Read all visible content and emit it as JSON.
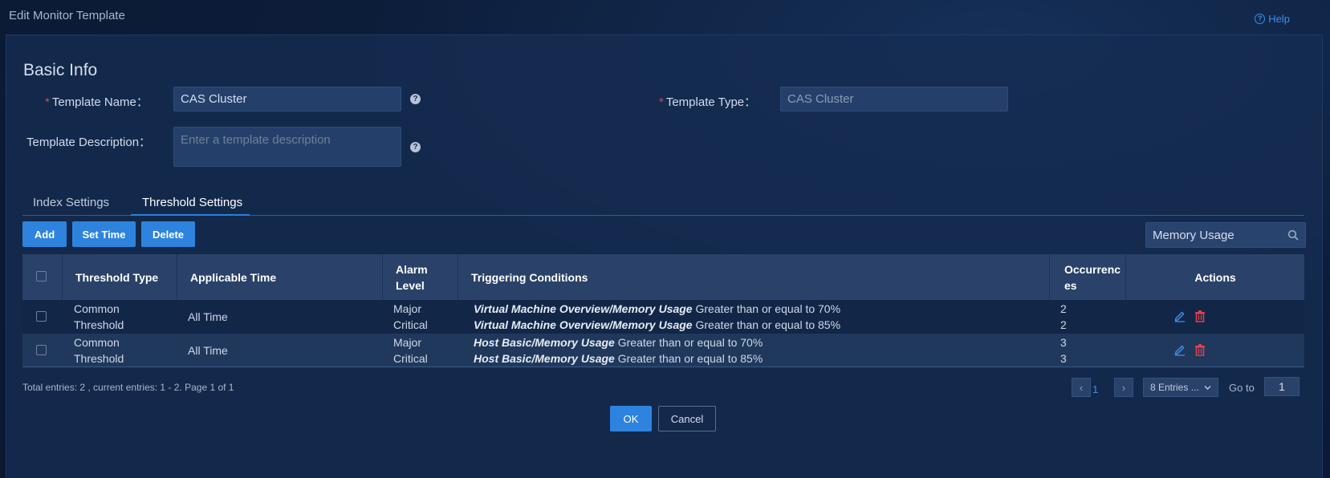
{
  "window": {
    "title": "Edit Monitor Template",
    "help_label": "Help"
  },
  "basic_info": {
    "section_title": "Basic Info",
    "template_name_label": "Template Name：",
    "template_name_value": "CAS Cluster",
    "template_type_label": "Template Type：",
    "template_type_value": "CAS Cluster",
    "template_description_label": "Template Description：",
    "template_description_placeholder": "Enter a template description",
    "required_mark": "*"
  },
  "tabs": [
    {
      "label": "Index Settings",
      "active": false
    },
    {
      "label": "Threshold Settings",
      "active": true
    }
  ],
  "toolbar": {
    "add_label": "Add",
    "set_time_label": "Set Time",
    "delete_label": "Delete",
    "search_value": "Memory Usage"
  },
  "table": {
    "headers": {
      "threshold_type": "Threshold Type",
      "applicable_time": "Applicable Time",
      "alarm_level": "Alarm Level",
      "triggering_conditions": "Triggering Conditions",
      "occurrences": "Occurrences",
      "actions": "Actions"
    },
    "rows": [
      {
        "threshold_type": "Common Threshold",
        "applicable_time": "All Time",
        "levels": [
          "Major",
          "Critical"
        ],
        "conditions": [
          {
            "metric": "Virtual Machine Overview/Memory Usage",
            "rule": " Greater than or equal to 70%"
          },
          {
            "metric": "Virtual Machine Overview/Memory Usage",
            "rule": " Greater than or equal to 85%"
          }
        ],
        "occurrences": [
          "2",
          "2"
        ]
      },
      {
        "threshold_type": "Common Threshold",
        "applicable_time": "All Time",
        "levels": [
          "Major",
          "Critical"
        ],
        "conditions": [
          {
            "metric": "Host Basic/Memory Usage",
            "rule": " Greater than or equal to 70%"
          },
          {
            "metric": "Host Basic/Memory Usage",
            "rule": " Greater than or equal to 85%"
          }
        ],
        "occurrences": [
          "3",
          "3"
        ]
      }
    ]
  },
  "pagination": {
    "summary": "Total entries: 2 , current entries: 1 - 2. Page 1 of 1",
    "current_page": "1",
    "page_size_label": "8 Entries ...",
    "goto_label": "Go to",
    "goto_value": "1"
  },
  "footer": {
    "ok_label": "OK",
    "cancel_label": "Cancel"
  },
  "colors": {
    "accent": "#2e83df",
    "danger": "#e0414d",
    "background": "#0c1d3a"
  }
}
